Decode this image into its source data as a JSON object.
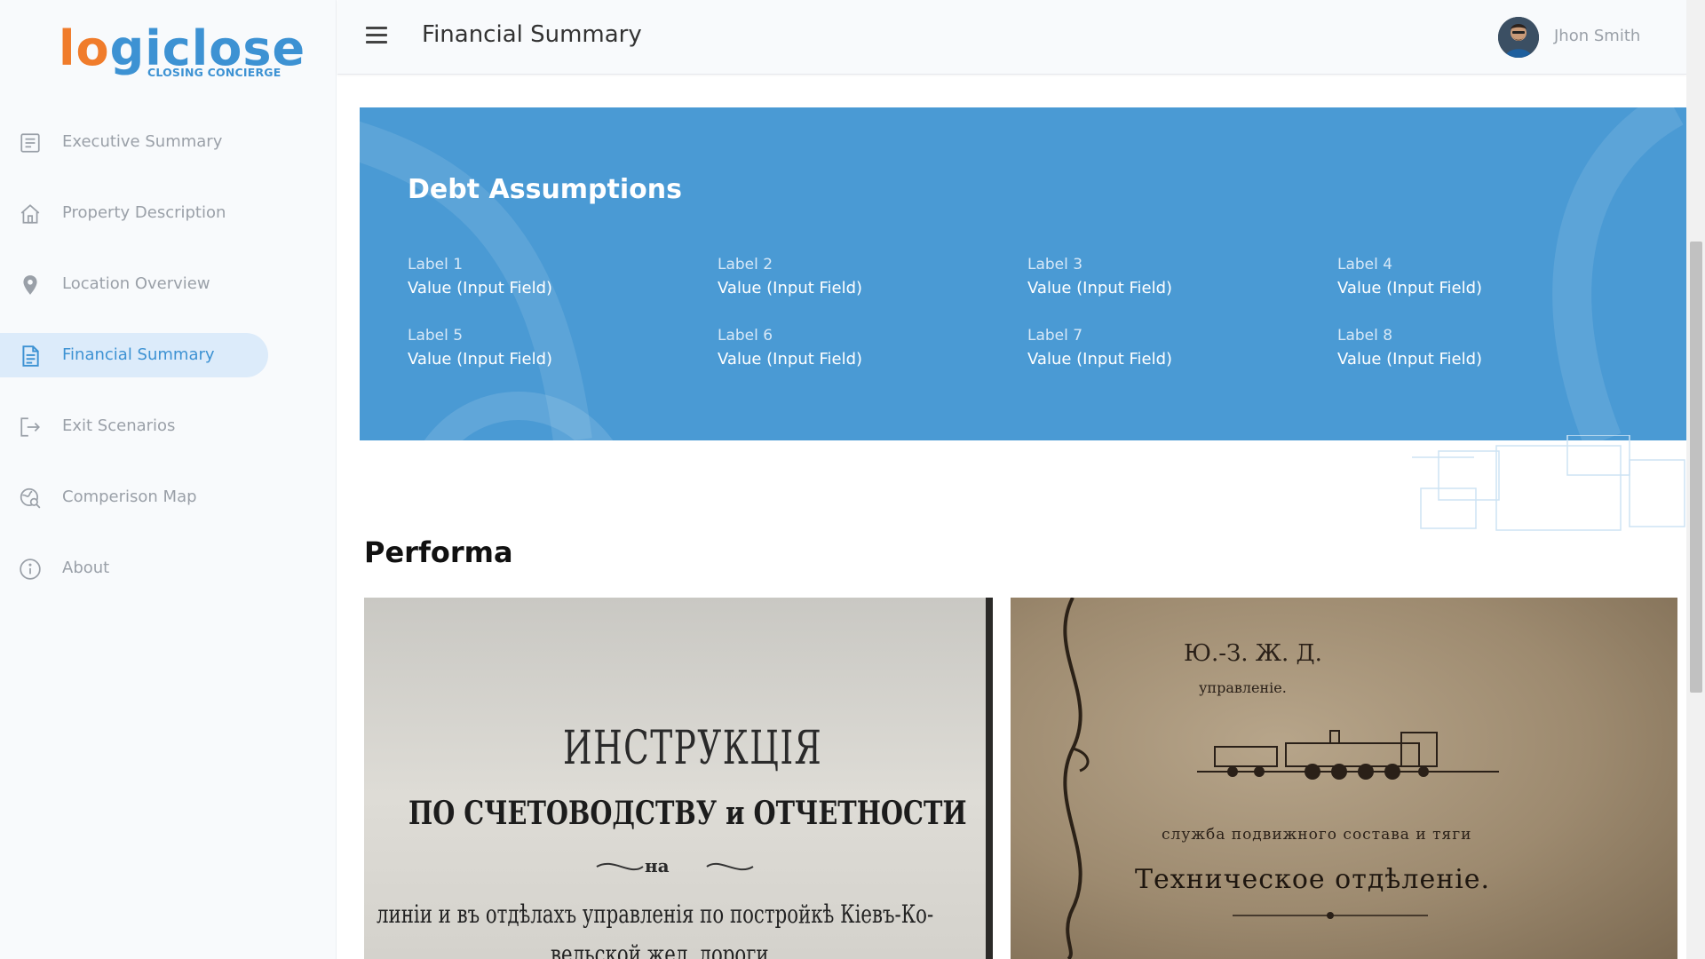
{
  "brand": {
    "logo_part1": "lo",
    "logo_part2": "giclose",
    "tagline": "CLOSING CONCIERGE"
  },
  "sidebar": {
    "items": [
      {
        "label": "Executive Summary",
        "icon": "document-list-icon",
        "active": false
      },
      {
        "label": "Property Description",
        "icon": "home-icon",
        "active": false
      },
      {
        "label": "Location Overview",
        "icon": "location-pin-icon",
        "active": false
      },
      {
        "label": "Financial Summary",
        "icon": "document-icon",
        "active": true
      },
      {
        "label": "Exit Scenarios",
        "icon": "exit-icon",
        "active": false
      },
      {
        "label": "Comperison Map",
        "icon": "map-search-icon",
        "active": false
      },
      {
        "label": "About",
        "icon": "info-icon",
        "active": false
      }
    ]
  },
  "header": {
    "title": "Financial Summary",
    "user_name": "Jhon Smith"
  },
  "debt": {
    "title": "Debt Assumptions",
    "fields": [
      {
        "label": "Label 1",
        "value": "Value (Input Field)"
      },
      {
        "label": "Label 2",
        "value": "Value (Input Field)"
      },
      {
        "label": "Label 3",
        "value": "Value (Input Field)"
      },
      {
        "label": "Label 4",
        "value": "Value (Input Field)"
      },
      {
        "label": "Label 5",
        "value": "Value (Input Field)"
      },
      {
        "label": "Label 6",
        "value": "Value (Input Field)"
      },
      {
        "label": "Label 7",
        "value": "Value (Input Field)"
      },
      {
        "label": "Label 8",
        "value": "Value (Input Field)"
      }
    ]
  },
  "performa": {
    "title": "Performa",
    "image1": {
      "line1": "ИНСТРУКЦІЯ",
      "line2": "ПО СЧЕТОВОДСТВУ и ОТЧЕТНОСТИ",
      "line3": "на",
      "line4": "линіи и въ отдѣлахъ управленія по постройкѣ Кіевъ-Ко-",
      "line5": "вельской жел. дороги"
    },
    "image2": {
      "line1": "Ю.-З. Ж. Д.",
      "line2": "управленіе.",
      "line3": "служба подвижного состава и тяги",
      "line4": "Техническое отдѣленіе."
    }
  },
  "colors": {
    "accent": "#4a9ad4",
    "active_bg": "#dcebfa",
    "logo_orange": "#f07c2b",
    "logo_blue": "#3d92d3"
  }
}
